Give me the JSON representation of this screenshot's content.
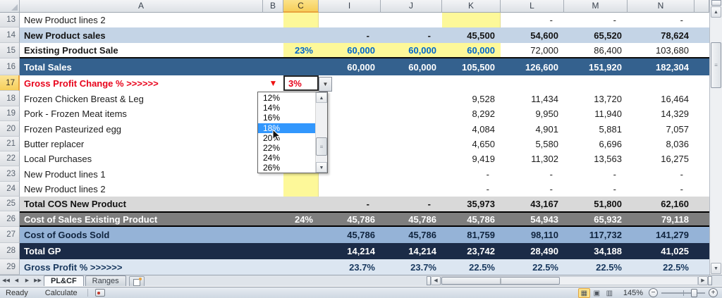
{
  "colors": {
    "band_blue": "#C4D4E6",
    "band_steel": "#34618E",
    "band_gray": "#D9D9D9",
    "band_darkgray": "#7E7E7E",
    "band_medblue": "#95B3D7",
    "band_navy": "#1B2B47",
    "band_lightblue": "#DCE6F1",
    "highlight_yellow": "#FDF899",
    "blue_text": "#0066CC",
    "red_text": "#E8041C",
    "selected_header_gold": "#F6CE59",
    "dropdown_selection_blue": "#3297FD"
  },
  "sheet": {
    "col_headers": [
      "A",
      "B",
      "C",
      "I",
      "J",
      "K",
      "L",
      "M",
      "N"
    ],
    "selected_col": "C",
    "selected_row": "17",
    "rows": [
      {
        "num": "13",
        "label": "New Product lines 2",
        "cls": "",
        "cells": [
          {
            "c": "C",
            "k": "y"
          },
          {
            "c": "K",
            "k": "y"
          },
          {
            "c": "L",
            "v": "-",
            "k": "dash"
          },
          {
            "c": "M",
            "v": "-",
            "k": "dash"
          },
          {
            "c": "N",
            "v": "-",
            "k": "dash"
          }
        ]
      },
      {
        "num": "14",
        "label": "New Product sales",
        "cls": "band-blue",
        "cells": [
          {
            "c": "I",
            "v": "-",
            "k": "dash"
          },
          {
            "c": "J",
            "v": "-",
            "k": "dash"
          },
          {
            "c": "K",
            "v": "45,500"
          },
          {
            "c": "L",
            "v": "54,600"
          },
          {
            "c": "M",
            "v": "65,520"
          },
          {
            "c": "N",
            "v": "78,624"
          }
        ]
      },
      {
        "num": "15",
        "label": "Existing Product Sale",
        "cls": "r15",
        "cells": [
          {
            "c": "C",
            "v": "23%",
            "k": "by"
          },
          {
            "c": "I",
            "v": "60,000",
            "k": "by"
          },
          {
            "c": "J",
            "v": "60,000",
            "k": "by"
          },
          {
            "c": "K",
            "v": "60,000",
            "k": "by"
          },
          {
            "c": "L",
            "v": "72,000"
          },
          {
            "c": "M",
            "v": "86,400"
          },
          {
            "c": "N",
            "v": "103,680"
          }
        ]
      },
      {
        "num": "16",
        "label": "Total Sales",
        "cls": "band-steel",
        "cells": [
          {
            "c": "I",
            "v": "60,000"
          },
          {
            "c": "J",
            "v": "60,000"
          },
          {
            "c": "K",
            "v": "105,500"
          },
          {
            "c": "L",
            "v": "126,600"
          },
          {
            "c": "M",
            "v": "151,920"
          },
          {
            "c": "N",
            "v": "182,304"
          }
        ]
      },
      {
        "num": "17",
        "label": "Gross Profit Change % >>>>>>",
        "cls": "r17",
        "cells": [
          {
            "c": "B",
            "k": "tri",
            "icon": "red-down-triangle"
          },
          {
            "c": "C",
            "v": "3%",
            "k": "active"
          }
        ]
      },
      {
        "num": "18",
        "label": "Frozen Chicken Breast & Leg",
        "cls": "",
        "cells": [
          {
            "c": "K",
            "v": "9,528"
          },
          {
            "c": "L",
            "v": "11,434"
          },
          {
            "c": "M",
            "v": "13,720"
          },
          {
            "c": "N",
            "v": "16,464"
          }
        ]
      },
      {
        "num": "19",
        "label": "Pork - Frozen Meat items",
        "cls": "",
        "cells": [
          {
            "c": "K",
            "v": "8,292"
          },
          {
            "c": "L",
            "v": "9,950"
          },
          {
            "c": "M",
            "v": "11,940"
          },
          {
            "c": "N",
            "v": "14,329"
          }
        ]
      },
      {
        "num": "20",
        "label": "Frozen Pasteurized egg",
        "cls": "",
        "cells": [
          {
            "c": "K",
            "v": "4,084"
          },
          {
            "c": "L",
            "v": "4,901"
          },
          {
            "c": "M",
            "v": "5,881"
          },
          {
            "c": "N",
            "v": "7,057"
          }
        ]
      },
      {
        "num": "21",
        "label": "Butter replacer",
        "cls": "",
        "cells": [
          {
            "c": "K",
            "v": "4,650"
          },
          {
            "c": "L",
            "v": "5,580"
          },
          {
            "c": "M",
            "v": "6,696"
          },
          {
            "c": "N",
            "v": "8,036"
          }
        ]
      },
      {
        "num": "22",
        "label": "Local Purchases",
        "cls": "",
        "cells": [
          {
            "c": "K",
            "v": "9,419"
          },
          {
            "c": "L",
            "v": "11,302"
          },
          {
            "c": "M",
            "v": "13,563"
          },
          {
            "c": "N",
            "v": "16,275"
          }
        ]
      },
      {
        "num": "23",
        "label": "New Product lines 1",
        "cls": "",
        "cells": [
          {
            "c": "C",
            "k": "y"
          },
          {
            "c": "K",
            "v": "-",
            "k": "dash"
          },
          {
            "c": "L",
            "v": "-",
            "k": "dash"
          },
          {
            "c": "M",
            "v": "-",
            "k": "dash"
          },
          {
            "c": "N",
            "v": "-",
            "k": "dash"
          }
        ]
      },
      {
        "num": "24",
        "label": "New Product lines 2",
        "cls": "",
        "cells": [
          {
            "c": "C",
            "k": "y"
          },
          {
            "c": "K",
            "v": "-",
            "k": "dash"
          },
          {
            "c": "L",
            "v": "-",
            "k": "dash"
          },
          {
            "c": "M",
            "v": "-",
            "k": "dash"
          },
          {
            "c": "N",
            "v": "-",
            "k": "dash"
          }
        ]
      },
      {
        "num": "25",
        "label": "Total COS New Product",
        "cls": "band-gray",
        "cells": [
          {
            "c": "I",
            "v": "-",
            "k": "dash"
          },
          {
            "c": "J",
            "v": "-",
            "k": "dash"
          },
          {
            "c": "K",
            "v": "35,973"
          },
          {
            "c": "L",
            "v": "43,167"
          },
          {
            "c": "M",
            "v": "51,800"
          },
          {
            "c": "N",
            "v": "62,160"
          }
        ]
      },
      {
        "num": "26",
        "label": "Cost of Sales Existing Product",
        "cls": "band-darkgray",
        "cells": [
          {
            "c": "C",
            "v": "24%"
          },
          {
            "c": "I",
            "v": "45,786"
          },
          {
            "c": "J",
            "v": "45,786"
          },
          {
            "c": "K",
            "v": "45,786"
          },
          {
            "c": "L",
            "v": "54,943"
          },
          {
            "c": "M",
            "v": "65,932"
          },
          {
            "c": "N",
            "v": "79,118"
          }
        ]
      },
      {
        "num": "27",
        "label": "Cost of Goods Sold",
        "cls": "band-medblue",
        "cells": [
          {
            "c": "I",
            "v": "45,786"
          },
          {
            "c": "J",
            "v": "45,786"
          },
          {
            "c": "K",
            "v": "81,759"
          },
          {
            "c": "L",
            "v": "98,110"
          },
          {
            "c": "M",
            "v": "117,732"
          },
          {
            "c": "N",
            "v": "141,279"
          }
        ]
      },
      {
        "num": "28",
        "label": "Total GP",
        "cls": "band-navy",
        "cells": [
          {
            "c": "I",
            "v": "14,214"
          },
          {
            "c": "J",
            "v": "14,214"
          },
          {
            "c": "K",
            "v": "23,742"
          },
          {
            "c": "L",
            "v": "28,490"
          },
          {
            "c": "M",
            "v": "34,188"
          },
          {
            "c": "N",
            "v": "41,025"
          }
        ]
      },
      {
        "num": "29",
        "label": "Gross Profit % >>>>>>",
        "cls": "band-lightblue",
        "cells": [
          {
            "c": "I",
            "v": "23.7%"
          },
          {
            "c": "J",
            "v": "23.7%"
          },
          {
            "c": "K",
            "v": "22.5%"
          },
          {
            "c": "L",
            "v": "22.5%"
          },
          {
            "c": "M",
            "v": "22.5%"
          },
          {
            "c": "N",
            "v": "22.5%"
          }
        ]
      }
    ]
  },
  "dropdown": {
    "cell_value": "3%",
    "options": [
      "12%",
      "14%",
      "16%",
      "18%",
      "20%",
      "22%",
      "24%",
      "26%"
    ],
    "selected_option": "18%"
  },
  "tabs": {
    "sheets": [
      {
        "label": "PL&CF",
        "active": true
      },
      {
        "label": "Ranges",
        "active": false
      }
    ]
  },
  "status": {
    "mode": "Ready",
    "calculate": "Calculate",
    "zoom_level": "145%"
  }
}
